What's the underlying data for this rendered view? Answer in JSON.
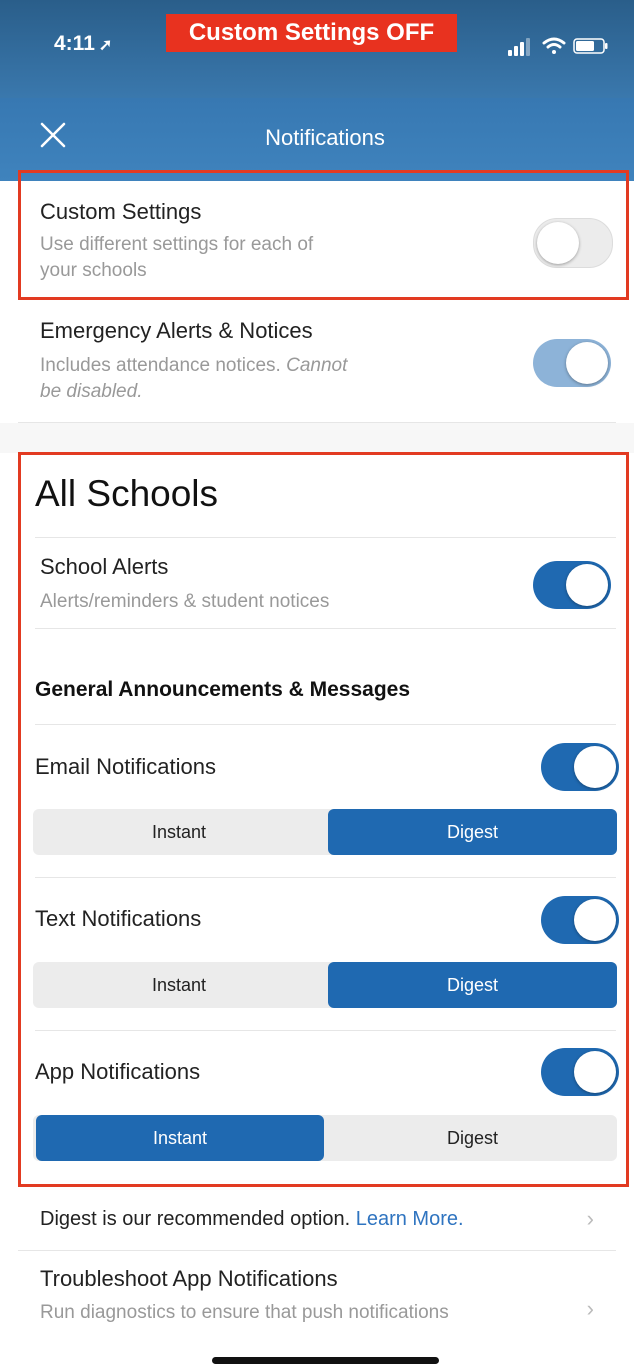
{
  "status": {
    "time": "4:11",
    "location_icon": "location-arrow-icon",
    "banner": "Custom Settings OFF"
  },
  "header": {
    "title": "Notifications",
    "close_icon": "close-icon"
  },
  "custom_settings": {
    "label": "Custom Settings",
    "sub": "Use different settings for each of your schools",
    "sub_line1": "Use different settings for each of",
    "sub_line2": "your schools",
    "toggle_on": false
  },
  "emergency": {
    "label": "Emergency Alerts & Notices",
    "sub_line1": "Includes attendance notices.",
    "sub_italic_1": "Cannot",
    "sub_italic_2": "be disabled.",
    "toggle_on": true,
    "toggle_disabled": true
  },
  "all_schools": {
    "heading": "All Schools",
    "school_alerts": {
      "label": "School Alerts",
      "sub": "Alerts/reminders & student notices",
      "toggle_on": true
    },
    "section_title": "General Announcements & Messages",
    "email": {
      "label": "Email Notifications",
      "toggle_on": true,
      "options": [
        "Instant",
        "Digest"
      ],
      "selected": "Digest"
    },
    "text": {
      "label": "Text Notifications",
      "toggle_on": true,
      "options": [
        "Instant",
        "Digest"
      ],
      "selected": "Digest"
    },
    "app": {
      "label": "App Notifications",
      "toggle_on": true,
      "options": [
        "Instant",
        "Digest"
      ],
      "selected": "Instant"
    }
  },
  "footer": {
    "digest_text": "Digest is our recommended option.",
    "learn_more": "Learn More.",
    "troubleshoot_label": "Troubleshoot App Notifications",
    "troubleshoot_sub": "Run diagnostics to ensure that push notifications",
    "chevron_icon": "chevron-right-icon"
  },
  "colors": {
    "accent": "#1f69b1",
    "header": "#3a7cb7",
    "annotation": "#e23a21"
  }
}
